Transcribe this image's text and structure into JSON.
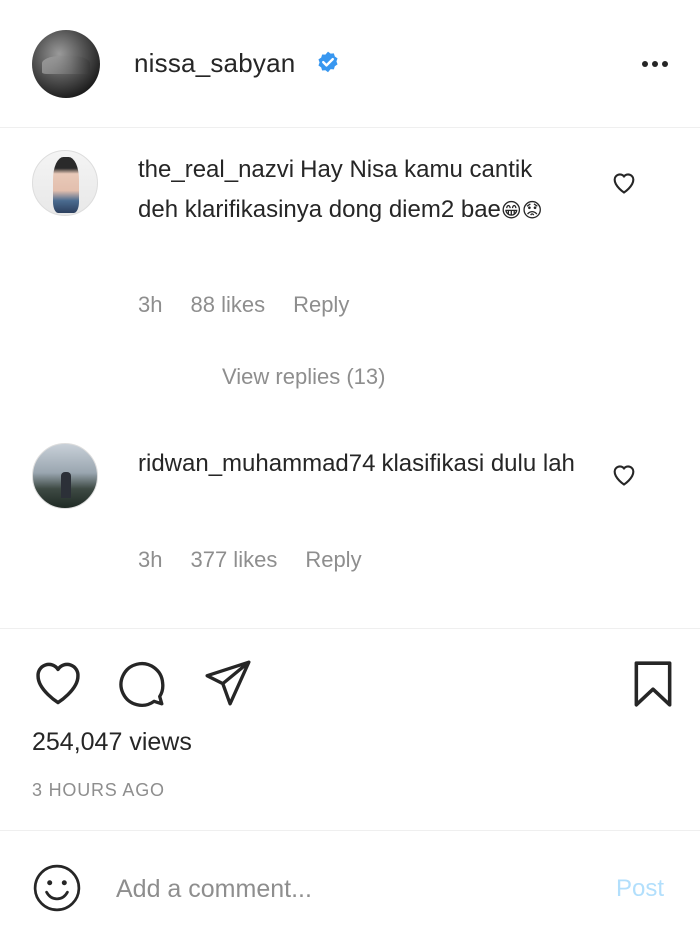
{
  "post": {
    "username": "nissa_sabyan",
    "verified_icon": "verified-badge-icon",
    "more_icon": "more-options-icon"
  },
  "comments": [
    {
      "username": "the_real_nazvi",
      "text": "Hay Nisa kamu cantik deh klarifikasinya dong diem2 bae",
      "emojis": [
        "😁",
        "😟"
      ],
      "time": "3h",
      "likes": "88 likes",
      "reply": "Reply",
      "view_replies": "View replies (13)"
    },
    {
      "username": "ridwan_muhammad74",
      "text": "klasifikasi dulu lah",
      "time": "3h",
      "likes": "377 likes",
      "reply": "Reply"
    }
  ],
  "actions": {
    "like_icon": "heart-icon",
    "comment_icon": "comment-icon",
    "share_icon": "share-icon",
    "save_icon": "bookmark-icon"
  },
  "views": "254,047 views",
  "timestamp": "3 HOURS AGO",
  "add_comment": {
    "placeholder": "Add a comment...",
    "post_label": "Post",
    "emoji_icon": "smile-icon"
  },
  "colors": {
    "text": "#262626",
    "secondary": "#8e8e8e",
    "verified": "#3897f0",
    "post_disabled": "#b2dffc",
    "emoji": "#f7c531"
  }
}
